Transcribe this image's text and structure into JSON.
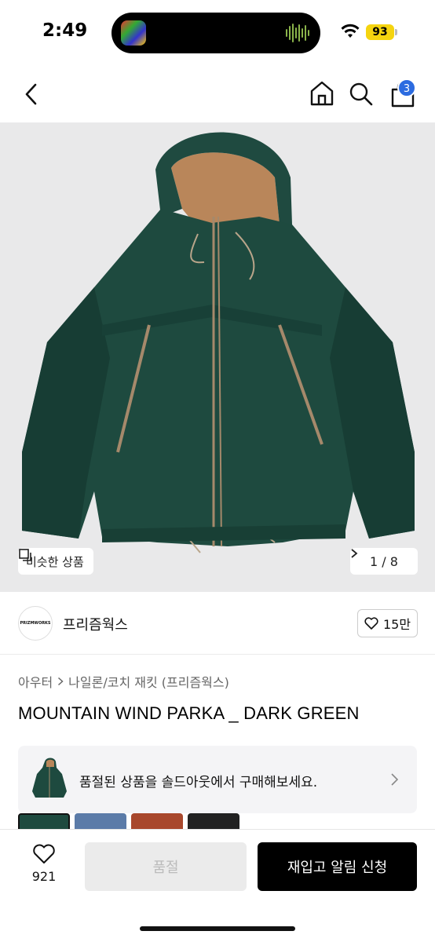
{
  "status": {
    "time": "2:49",
    "battery": "93"
  },
  "nav": {
    "cart_count": "3"
  },
  "gallery": {
    "similar_label": "비슷한 상품",
    "page_indicator": "1 / 8"
  },
  "brand": {
    "name": "프리즘웍스",
    "logo_text": "PRIZMWORKS",
    "likes": "15만"
  },
  "category": {
    "parent": "아우터",
    "sub": "나일론/코치 재킷 (프리즘웍스)"
  },
  "product": {
    "title": "MOUNTAIN WIND PARKA _ DARK GREEN",
    "accent_color": "#1e4a3f",
    "lining_color": "#b9865a"
  },
  "soldout_banner": {
    "text": "품절된 상품을 솔드아웃에서 구매해보세요."
  },
  "variant_colors": [
    "#1e4a3f",
    "#5b7ba8",
    "#a8472c",
    "#222222"
  ],
  "bottom_bar": {
    "wish_count": "921",
    "soldout_label": "품절",
    "restock_label": "재입고 알림 신청"
  }
}
